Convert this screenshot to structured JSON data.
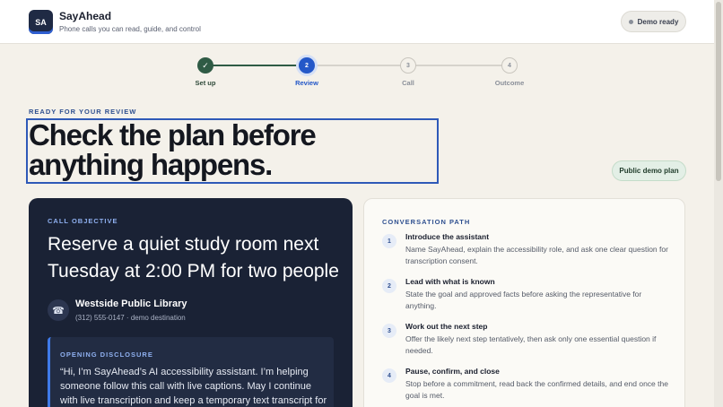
{
  "header": {
    "logo_text": "SA",
    "app_name": "SayAhead",
    "tagline": "Phone calls you can read, guide, and control",
    "status": "Demo ready"
  },
  "stepper": {
    "steps": [
      {
        "number": "✓",
        "label": "Set up",
        "state": "complete"
      },
      {
        "number": "2",
        "label": "Review",
        "state": "current"
      },
      {
        "number": "3",
        "label": "Call",
        "state": "upcoming"
      },
      {
        "number": "4",
        "label": "Outcome",
        "state": "upcoming"
      }
    ]
  },
  "review": {
    "eyebrow": "READY FOR YOUR REVIEW",
    "headline": "Check the plan before anything happens.",
    "plan_badge": "Public demo plan"
  },
  "objective": {
    "eyebrow": "CALL OBJECTIVE",
    "text": "Reserve a quiet study room next Tuesday at 2:00 PM for two people",
    "destination_name": "Westside Public Library",
    "destination_meta": "(312) 555-0147 · demo destination",
    "disclosure_label": "OPENING DISCLOSURE",
    "disclosure_text": "“Hi, I’m SayAhead’s AI accessibility assistant. I’m helping someone follow this call with live captions. May I continue with live transcription and keep a temporary text transcript for them to"
  },
  "conversation_path": {
    "eyebrow": "CONVERSATION PATH",
    "steps": [
      {
        "number": "1",
        "title": "Introduce the assistant",
        "description": "Name SayAhead, explain the accessibility role, and ask one clear question for transcription consent."
      },
      {
        "number": "2",
        "title": "Lead with what is known",
        "description": "State the goal and approved facts before asking the representative for anything."
      },
      {
        "number": "3",
        "title": "Work out the next step",
        "description": "Offer the likely next step tentatively, then ask only one essential question if needed."
      },
      {
        "number": "4",
        "title": "Pause, confirm, and close",
        "description": "Stop before a commitment, read back the confirmed details, and end once the goal is met."
      }
    ]
  },
  "colors": {
    "accent": "#2e59b8",
    "complete": "#2f5b45",
    "dark_card": "#1a2235",
    "page_bg": "#f4f1ea"
  },
  "icons": {
    "step_complete": "check-icon",
    "destination": "phone-icon"
  }
}
